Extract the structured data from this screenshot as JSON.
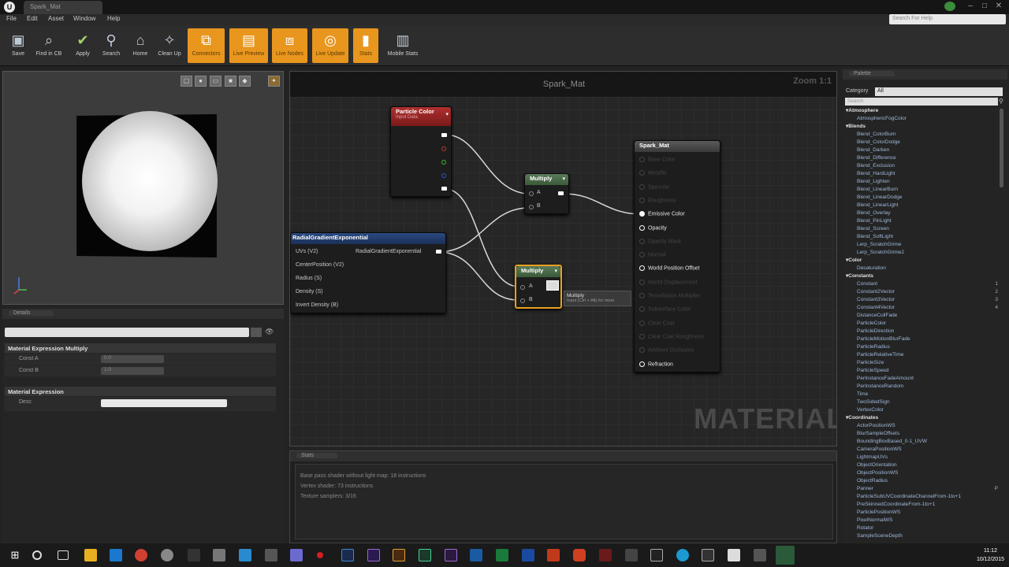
{
  "titlebar": {
    "tab": "Spark_Mat"
  },
  "menu": [
    "File",
    "Edit",
    "Asset",
    "Window",
    "Help"
  ],
  "help_search_placeholder": "Search For Help",
  "toolbar": [
    {
      "label": "Save",
      "icon": "save-icon",
      "active": false
    },
    {
      "label": "Find in CB",
      "icon": "find-icon",
      "active": false
    },
    {
      "label": "Apply",
      "icon": "apply-icon",
      "active": false
    },
    {
      "label": "Search",
      "icon": "search-icon",
      "active": false
    },
    {
      "label": "Home",
      "icon": "home-icon",
      "active": false
    },
    {
      "label": "Clean Up",
      "icon": "cleanup-icon",
      "active": false
    },
    {
      "label": "Connectors",
      "icon": "connectors-icon",
      "active": true
    },
    {
      "label": "Live Preview",
      "icon": "live-preview-icon",
      "active": true
    },
    {
      "label": "Live Nodes",
      "icon": "live-nodes-icon",
      "active": true
    },
    {
      "label": "Live Update",
      "icon": "live-update-icon",
      "active": true
    },
    {
      "label": "Stats",
      "icon": "stats-icon",
      "active": true
    },
    {
      "label": "Mobile Stats",
      "icon": "mobile-stats-icon",
      "active": false
    }
  ],
  "details": {
    "tab": "Details",
    "section1": "Material Expression Multiply",
    "const_a_label": "Const A",
    "const_a": "0.0",
    "const_b_label": "Const B",
    "const_b": "1.0",
    "section2": "Material Expression",
    "desc_label": "Desc"
  },
  "graph": {
    "title": "Spark_Mat",
    "zoom": "Zoom 1:1",
    "watermark": "MATERIAL",
    "particle_color": {
      "title": "Particle Color",
      "subtitle": "Input Data"
    },
    "radial": {
      "title": "RadialGradientExponential",
      "inputs": [
        "UVs (V2)",
        "CenterPosition (V2)",
        "Radius (S)",
        "Density (S)",
        "Invert Density (B)"
      ],
      "output": "RadialGradientExponential"
    },
    "multiply1": {
      "title": "Multiply",
      "a": "A",
      "b": "B"
    },
    "multiply2": {
      "title": "Multiply",
      "a": "A",
      "b": "B",
      "tooltip": "Multiply",
      "tooltip_sub": "Input (Ctrl + Alt) for more"
    },
    "spark_mat": {
      "title": "Spark_Mat",
      "pins": [
        {
          "label": "Base Color",
          "active": false
        },
        {
          "label": "Metallic",
          "active": false
        },
        {
          "label": "Specular",
          "active": false
        },
        {
          "label": "Roughness",
          "active": false
        },
        {
          "label": "Emissive Color",
          "active": true
        },
        {
          "label": "Opacity",
          "active": true
        },
        {
          "label": "Opacity Mask",
          "active": false
        },
        {
          "label": "Normal",
          "active": false
        },
        {
          "label": "World Position Offset",
          "active": true
        },
        {
          "label": "World Displacement",
          "active": false
        },
        {
          "label": "Tessellation Multiplier",
          "active": false
        },
        {
          "label": "Subsurface Color",
          "active": false
        },
        {
          "label": "Clear Coat",
          "active": false
        },
        {
          "label": "Clear Coat Roughness",
          "active": false
        },
        {
          "label": "Ambient Occlusion",
          "active": false
        },
        {
          "label": "Refraction",
          "active": true
        }
      ]
    }
  },
  "stats": {
    "tab": "Stats",
    "lines": [
      "Base pass shader without light map: 18 instructions",
      "Vertex shader: 73 instructions",
      "Texture samplers: 3/16"
    ]
  },
  "palette": {
    "tab": "Palette",
    "category_label": "Category",
    "category_value": "All",
    "search_placeholder": "Search",
    "items": [
      {
        "t": "c",
        "n": "Atmosphere"
      },
      {
        "t": "i",
        "n": "AtmosphericFogColor"
      },
      {
        "t": "c",
        "n": "Blends"
      },
      {
        "t": "i",
        "n": "Blend_ColorBurn"
      },
      {
        "t": "i",
        "n": "Blend_ColorDodge"
      },
      {
        "t": "i",
        "n": "Blend_Darken"
      },
      {
        "t": "i",
        "n": "Blend_Difference"
      },
      {
        "t": "i",
        "n": "Blend_Exclusion"
      },
      {
        "t": "i",
        "n": "Blend_HardLight"
      },
      {
        "t": "i",
        "n": "Blend_Lighten"
      },
      {
        "t": "i",
        "n": "Blend_LinearBurn"
      },
      {
        "t": "i",
        "n": "Blend_LinearDodge"
      },
      {
        "t": "i",
        "n": "Blend_LinearLight"
      },
      {
        "t": "i",
        "n": "Blend_Overlay"
      },
      {
        "t": "i",
        "n": "Blend_PinLight"
      },
      {
        "t": "i",
        "n": "Blend_Screen"
      },
      {
        "t": "i",
        "n": "Blend_SoftLight"
      },
      {
        "t": "i",
        "n": "Lerp_ScratchGrime"
      },
      {
        "t": "i",
        "n": "Lerp_ScratchGrime2"
      },
      {
        "t": "c",
        "n": "Color"
      },
      {
        "t": "i",
        "n": "Desaturation"
      },
      {
        "t": "c",
        "n": "Constants"
      },
      {
        "t": "i",
        "n": "Constant",
        "k": "1"
      },
      {
        "t": "i",
        "n": "Constant2Vector",
        "k": "2"
      },
      {
        "t": "i",
        "n": "Constant3Vector",
        "k": "3"
      },
      {
        "t": "i",
        "n": "Constant4Vector",
        "k": "4"
      },
      {
        "t": "i",
        "n": "DistanceCullFade"
      },
      {
        "t": "i",
        "n": "ParticleColor"
      },
      {
        "t": "i",
        "n": "ParticleDirection"
      },
      {
        "t": "i",
        "n": "ParticleMotionBlurFade"
      },
      {
        "t": "i",
        "n": "ParticleRadius"
      },
      {
        "t": "i",
        "n": "ParticleRelativeTime"
      },
      {
        "t": "i",
        "n": "ParticleSize"
      },
      {
        "t": "i",
        "n": "ParticleSpeed"
      },
      {
        "t": "i",
        "n": "PerInstanceFadeAmount"
      },
      {
        "t": "i",
        "n": "PerInstanceRandom"
      },
      {
        "t": "i",
        "n": "Time"
      },
      {
        "t": "i",
        "n": "TwoSidedSign"
      },
      {
        "t": "i",
        "n": "VertexColor"
      },
      {
        "t": "c",
        "n": "Coordinates"
      },
      {
        "t": "i",
        "n": "ActorPositionWS"
      },
      {
        "t": "i",
        "n": "BlurSampleOffsets"
      },
      {
        "t": "i",
        "n": "BoundingBoxBased_0-1_UVW"
      },
      {
        "t": "i",
        "n": "CameraPositionWS"
      },
      {
        "t": "i",
        "n": "LightmapUVs"
      },
      {
        "t": "i",
        "n": "ObjectOrientation"
      },
      {
        "t": "i",
        "n": "ObjectPositionWS"
      },
      {
        "t": "i",
        "n": "ObjectRadius"
      },
      {
        "t": "i",
        "n": "Panner",
        "k": "P"
      },
      {
        "t": "i",
        "n": "ParticleSubUVCoordinateChannelFrom-1to+1"
      },
      {
        "t": "i",
        "n": "PreSkinnedCoordinateFrom-1to+1"
      },
      {
        "t": "i",
        "n": "ParticlePositionWS"
      },
      {
        "t": "i",
        "n": "PixelNormalWS"
      },
      {
        "t": "i",
        "n": "Rotator"
      },
      {
        "t": "i",
        "n": "SampleSceneDepth"
      }
    ]
  },
  "taskbar": {
    "time": "11:12",
    "date": "10/12/2015"
  }
}
